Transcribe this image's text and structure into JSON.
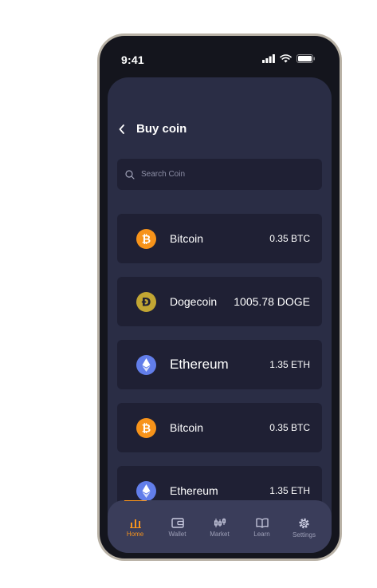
{
  "status": {
    "time": "9:41"
  },
  "header": {
    "title": "Buy coin"
  },
  "search": {
    "placeholder": "Search Coin"
  },
  "coins": [
    {
      "name": "Bitcoin",
      "amount": "0.35 BTC",
      "icon": "bitcoin-icon",
      "color": "#f7931a"
    },
    {
      "name": "Dogecoin",
      "amount": "1005.78 DOGE",
      "icon": "dogecoin-icon",
      "color": "#c2a633"
    },
    {
      "name": "Ethereum",
      "amount": "1.35 ETH",
      "icon": "ethereum-icon",
      "color": "#627eea"
    },
    {
      "name": "Bitcoin",
      "amount": "0.35 BTC",
      "icon": "bitcoin-icon",
      "color": "#f7931a"
    },
    {
      "name": "Ethereum",
      "amount": "1.35 ETH",
      "icon": "ethereum-icon",
      "color": "#627eea"
    }
  ],
  "tabs": [
    {
      "label": "Home",
      "icon": "chart-bar-icon",
      "active": true
    },
    {
      "label": "Wallet",
      "icon": "wallet-icon"
    },
    {
      "label": "Market",
      "icon": "candlestick-icon"
    },
    {
      "label": "Learn",
      "icon": "book-icon"
    },
    {
      "label": "Settings",
      "icon": "gear-icon"
    }
  ],
  "colors": {
    "accent": "#f7941d",
    "background": "#2a2d45",
    "card": "#1f2034",
    "tabbar": "#3a3d5a"
  }
}
